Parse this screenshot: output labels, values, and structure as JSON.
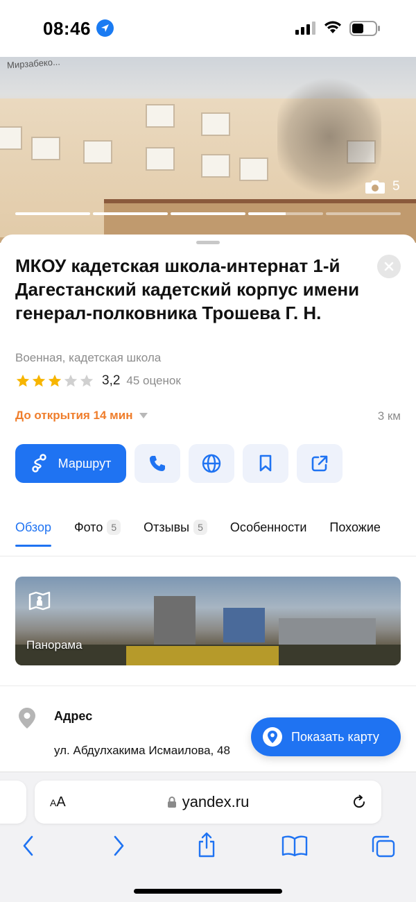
{
  "status_bar": {
    "time": "08:46",
    "icons": [
      "location-arrow-icon",
      "cellular-signal-icon",
      "wifi-icon",
      "battery-icon"
    ]
  },
  "photo": {
    "street_text": "Мирзабеко...",
    "photo_count": "5",
    "photos_total": 5,
    "current_photo_progress": 0.5
  },
  "place": {
    "title": "МКОУ кадетская школа-интернат 1-й Дагестанский кадетский корпус имени генерал-полковника Трошева Г. Н.",
    "category": "Военная, кадетская школа",
    "rating_value": "3,2",
    "rating_stars": 3,
    "rating_stars_max": 5,
    "reviews_count": "45 оценок",
    "open_status": "До открытия 14 мин",
    "distance": "3 км"
  },
  "actions": {
    "route_label": "Маршрут",
    "icons": [
      "route-icon",
      "phone-icon",
      "globe-icon",
      "bookmark-icon",
      "share-icon"
    ]
  },
  "tabs": [
    {
      "label": "Обзор",
      "count": ""
    },
    {
      "label": "Фото",
      "count": "5"
    },
    {
      "label": "Отзывы",
      "count": "5"
    },
    {
      "label": "Особенности",
      "count": ""
    },
    {
      "label": "Похожие",
      "count": ""
    }
  ],
  "panorama": {
    "label": "Панорама"
  },
  "address": {
    "label": "Адрес",
    "value": "ул. Абдулхакима Исмаилова, 48"
  },
  "show_map_label": "Показать карту",
  "browser": {
    "text_size_label_small": "A",
    "text_size_label_large": "A",
    "url": "yandex.ru"
  },
  "colors": {
    "accent": "#1f73f2",
    "open_status": "#ef7d2b",
    "star": "#f7b500",
    "star_empty": "#d0d0d0"
  }
}
